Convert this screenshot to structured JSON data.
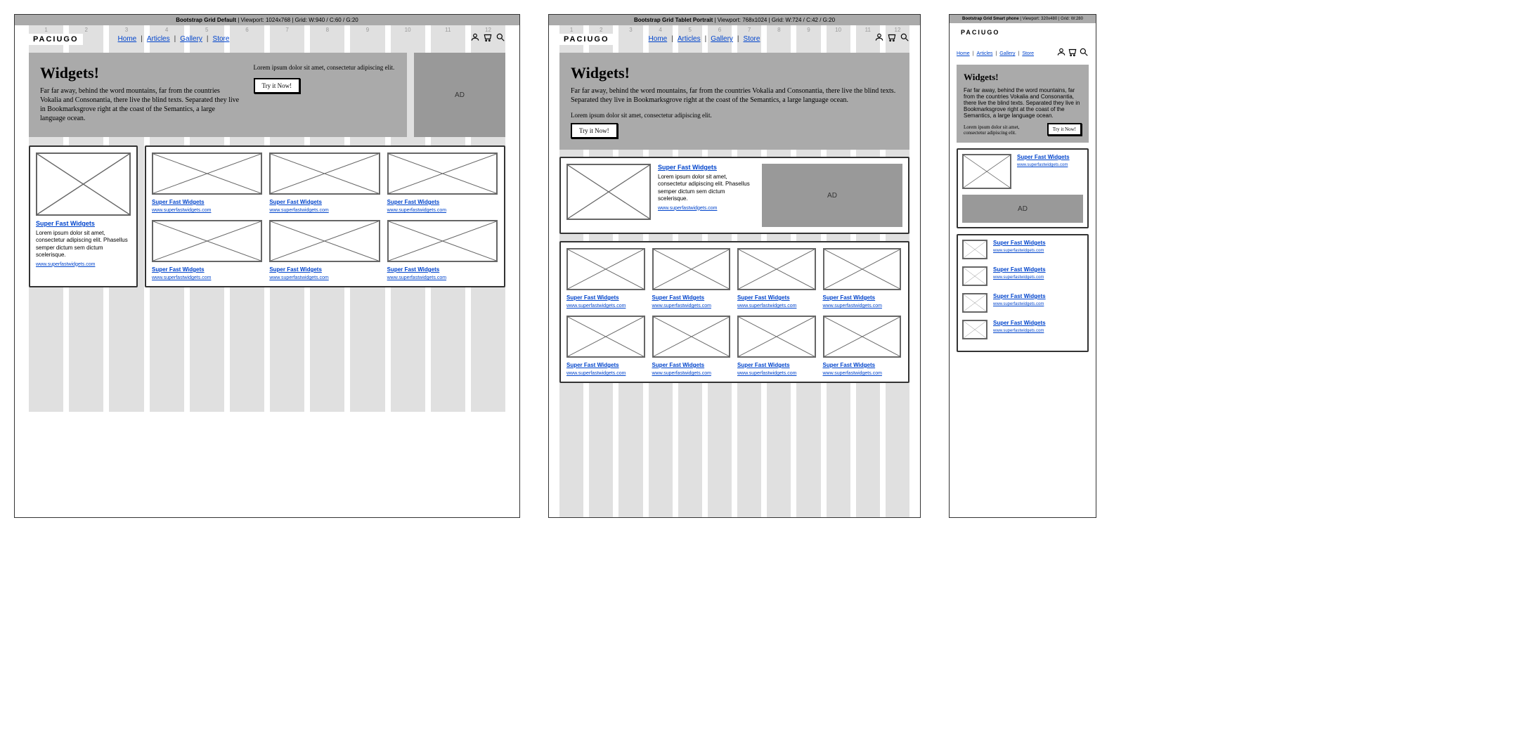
{
  "frames": {
    "desktop": {
      "title_bold": "Bootstrap Grid Default",
      "title_rest": " | Viewport: 1024x768 | Grid: W:940 / C:60 / G:20"
    },
    "tablet": {
      "title_bold": "Bootstrap Grid Tablet Portrait",
      "title_rest": " | Viewport: 768x1024 | Grid: W:724 / C:42 / G:20"
    },
    "mobile": {
      "title_bold": "Bootstrap Grid Smart phone",
      "title_rest": " | Viewport: 320x480 | Grid: W:280"
    }
  },
  "brand": "PACIUGO",
  "nav": {
    "home": "Home",
    "articles": "Articles",
    "gallery": "Gallery",
    "store": "Store"
  },
  "hero": {
    "title": "Widgets!",
    "body": "Far far away, behind the word mountains, far from the countries Vokalia and Consonantia, there live the blind texts. Separated they live in Bookmarksgrove right at the coast of the Semantics, a large language ocean.",
    "side": "Lorem ipsum dolor sit amet, consectetur adipiscing elit.",
    "cta": "Try it Now!"
  },
  "ad": "AD",
  "item": {
    "title": "Super Fast Widgets",
    "desc": "Lorem ipsum dolor sit amet, consectetur adipiscing elit. Phasellus semper dictum sem dictum scelerisque.",
    "url": "www.superfastwidgets.com"
  }
}
